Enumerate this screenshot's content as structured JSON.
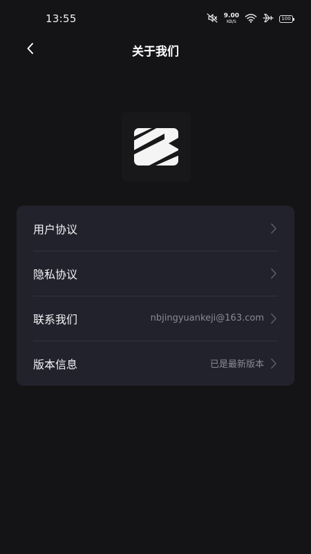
{
  "status_bar": {
    "time": "13:55",
    "net_speed_value": "9.00",
    "net_speed_unit": "KB/S",
    "battery_level": "100",
    "icons": [
      "mute-icon",
      "net-speed",
      "wifi-icon",
      "airplane-icon",
      "battery-icon"
    ]
  },
  "header": {
    "title": "关于我们",
    "back_icon": "chevron-left-icon"
  },
  "logo": {
    "icon": "app-logo"
  },
  "menu": {
    "items": [
      {
        "label": "用户协议",
        "value": ""
      },
      {
        "label": "隐私协议",
        "value": ""
      },
      {
        "label": "联系我们",
        "value": "nbjingyuankeji@163.com"
      },
      {
        "label": "版本信息",
        "value": "已是最新版本"
      }
    ]
  },
  "colors": {
    "background": "#141417",
    "card": "#22222d",
    "divider": "#34343f",
    "secondary_text": "#8b8b96"
  }
}
